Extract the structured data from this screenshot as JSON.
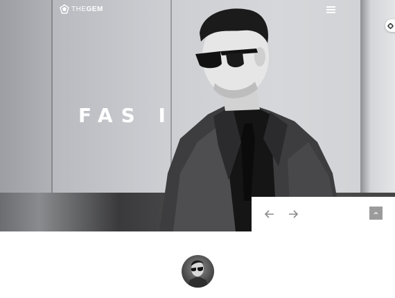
{
  "header": {
    "logo_prefix": "THE",
    "logo_suffix": "GEM"
  },
  "hero": {
    "title": "FAS I"
  },
  "icons": {
    "logo": "gem-logo-icon",
    "menu": "hamburger-menu-icon",
    "settings": "gear-icon",
    "prev": "arrow-left-icon",
    "next": "arrow-right-icon",
    "scroll_top": "chevron-up-icon"
  },
  "colors": {
    "hero_text": "#ffffff",
    "nav_background": "#ffffff",
    "scroll_top_button": "#9b9b9b",
    "arrow": "#8a8a8a"
  }
}
